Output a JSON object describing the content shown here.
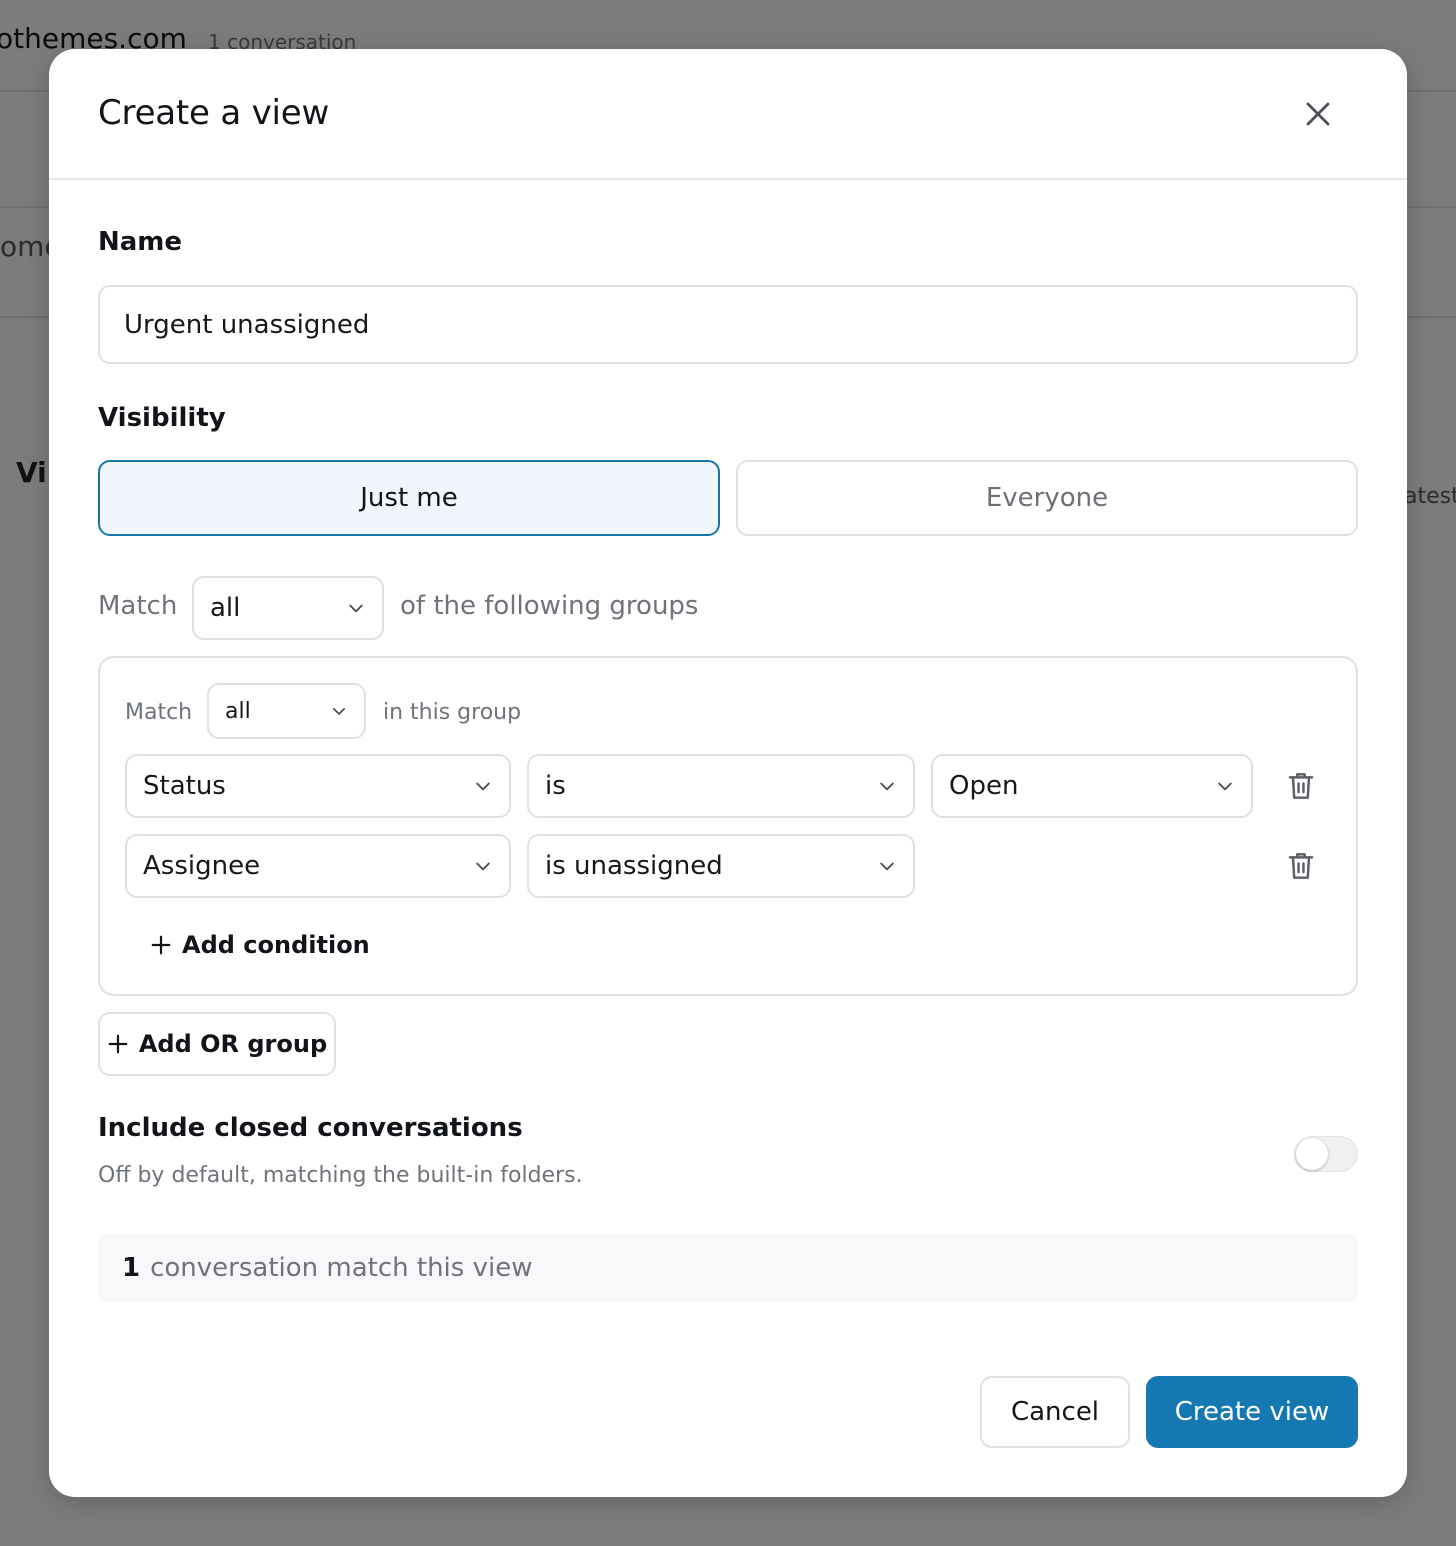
{
  "background": {
    "domain_fragment": "othemes.com",
    "conversation_count": "1 conversation",
    "tab_fragment": "ome",
    "heading_fragment": "Vi",
    "sort_fragment": "atest"
  },
  "modal": {
    "title": "Create a view",
    "name": {
      "label": "Name",
      "value": "Urgent unassigned"
    },
    "visibility": {
      "label": "Visibility",
      "options": [
        "Just me",
        "Everyone"
      ],
      "selected": "Just me"
    },
    "outer_match": {
      "prefix": "Match",
      "value": "all",
      "suffix": "of the following groups"
    },
    "group": {
      "prefix": "Match",
      "value": "all",
      "suffix": "in this group",
      "conditions": [
        {
          "field": "Status",
          "operator": "is",
          "value": "Open"
        },
        {
          "field": "Assignee",
          "operator": "is unassigned",
          "value": ""
        }
      ],
      "add_condition_label": "Add condition"
    },
    "add_or_group_label": "Add OR group",
    "include_closed": {
      "title": "Include closed conversations",
      "subtitle": "Off by default, matching the built-in folders.",
      "enabled": false
    },
    "match_summary": {
      "count": "1",
      "text": "conversation match this view"
    },
    "actions": {
      "cancel_label": "Cancel",
      "create_label": "Create view"
    }
  },
  "colors": {
    "accent": "#1578b0",
    "selected_border": "#1576a9",
    "selected_bg": "#f1f6fd",
    "muted_text": "#6f737a",
    "border": "#dfe1e5",
    "overlay": "#7c7b7e"
  },
  "icons": {
    "close": "close-icon",
    "chevron": "chevron-down-icon",
    "trash": "trash-icon",
    "plus": "plus-icon"
  }
}
